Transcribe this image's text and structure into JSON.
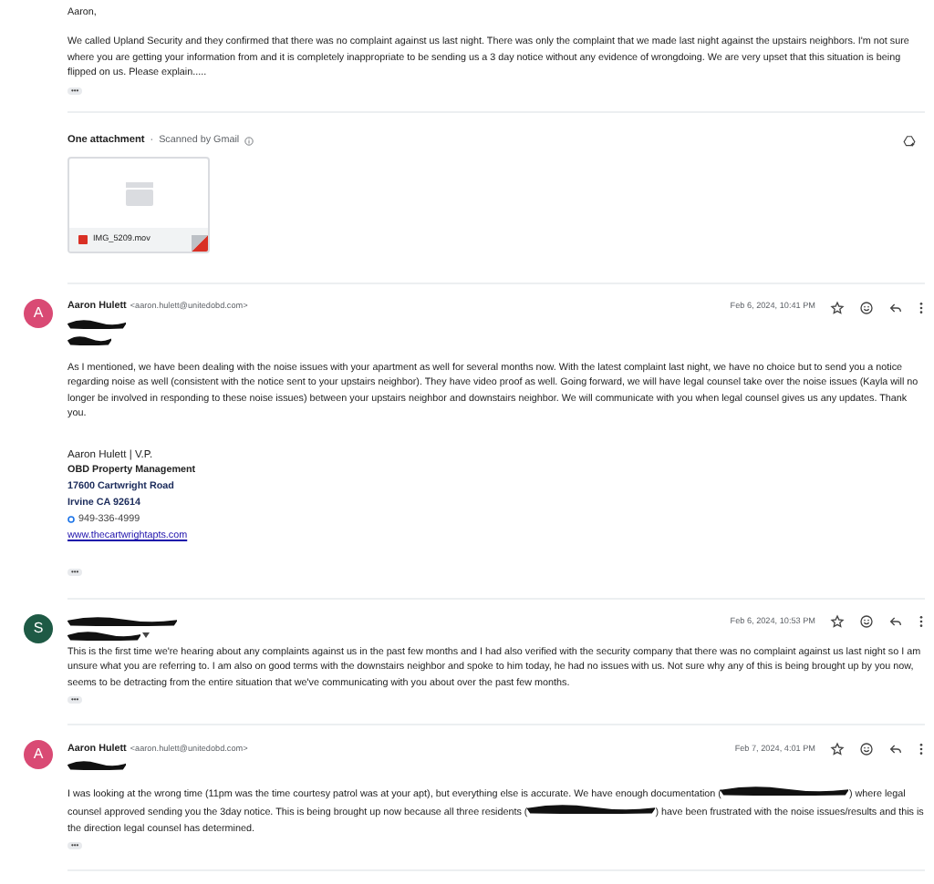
{
  "first_message": {
    "greeting": "Aaron,",
    "body": "We called Upland Security and they confirmed that there was no complaint against us last night. There was only the complaint that we made last night against the upstairs neighbors. I'm not sure where you are getting your information from and it is completely inappropriate to be sending us a 3 day notice without any evidence of wrongdoing. We are very upset that this situation is being flipped on us. Please explain.....",
    "more": "•••",
    "attachments": {
      "title": "One attachment",
      "separator": "·",
      "scan_note": "Scanned by Gmail",
      "files": [
        {
          "name": "IMG_5209.mov"
        }
      ]
    }
  },
  "messages": [
    {
      "sender": "Aaron Hulett",
      "email": "<aaron.hulett@unitedobd.com>",
      "avatar": "A",
      "color": "#d94a74",
      "sender_redacted": false,
      "header_lines": [
        {
          "kind": "redaction"
        },
        {
          "kind": "redaction"
        }
      ],
      "date": "Feb 6, 2024, 10:41 PM",
      "more": "•••",
      "body": [
        {
          "kind": "text",
          "text": "As I mentioned, we have been dealing with the noise issues with your apartment as well for several months now. With the latest complaint last night, we have no choice but to send you a notice regarding noise as well (consistent with the notice sent to your upstairs neighbor). They have video proof as well. Going forward, we will have legal counsel take over the noise issues (Kayla will no longer be involved in responding to these noise issues) between your upstairs neighbor and downstairs neighbor. We will communicate with you when legal counsel gives us any updates. Thank you."
        }
      ],
      "signature": {
        "name": "Aaron Hulett | V.P.",
        "company": "OBD Property Management",
        "street": "17600 Cartwright Road",
        "city": "Irvine CA 92614",
        "phone": "949-336-4999",
        "website": "www.thecartwrightapts.com"
      }
    },
    {
      "sender_redacted": true,
      "avatar": "S",
      "color": "#1e5a45",
      "header_lines": [
        {
          "kind": "redaction_with_caret"
        }
      ],
      "date": "Feb 6, 2024, 10:53 PM",
      "more": "•••",
      "body": [
        {
          "kind": "text",
          "text": "This is the first time we're hearing about any complaints against us in the past few months and I had also verified with the security company that there was no complaint against us last night so I am unsure what you are referring to. I am also on good terms with the downstairs neighbor and spoke to him today, he had no issues with us. Not sure why any of this is being brought up by you now, seems to be detracting from the entire situation that we've communicating with you about over the past few months."
        }
      ]
    },
    {
      "sender": "Aaron Hulett",
      "email": "<aaron.hulett@unitedobd.com>",
      "avatar": "A",
      "color": "#d94a74",
      "sender_redacted": false,
      "header_lines": [
        {
          "kind": "redaction"
        }
      ],
      "date": "Feb 7, 2024, 4:01 PM",
      "more": "•••",
      "body": [
        {
          "kind": "text",
          "text": "I was looking at the wrong time (11pm was the time courtesy patrol was at your apt), but everything else is accurate. We have enough documentation ("
        },
        {
          "kind": "redaction"
        },
        {
          "kind": "text",
          "text": ") where legal counsel approved sending you the 3day notice. This is being brought up now because all three residents ("
        },
        {
          "kind": "redaction"
        },
        {
          "kind": "text",
          "text": ") have been frustrated with the noise issues/results and this is the direction legal counsel has determined."
        }
      ]
    }
  ]
}
